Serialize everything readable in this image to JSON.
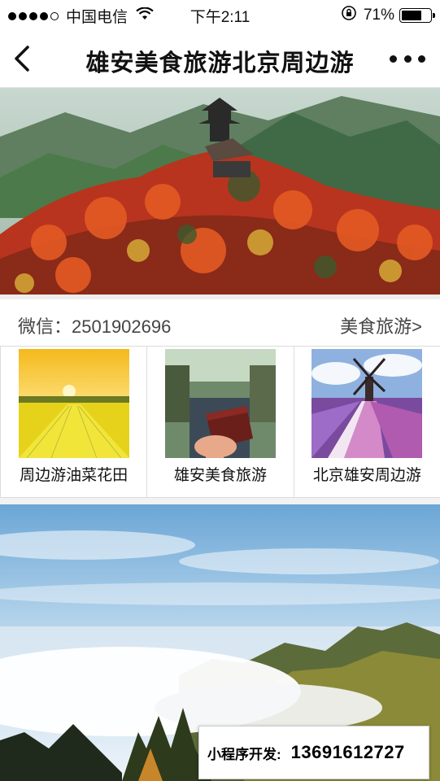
{
  "status_bar": {
    "carrier": "中国电信",
    "time": "下午2:11",
    "battery_percent": "71%",
    "battery_level": 0.71,
    "signal_icon": "signal-dots-icon",
    "wifi_icon": "wifi-icon",
    "lock_icon": "orientation-lock-icon"
  },
  "nav": {
    "title": "雄安美食旅游北京周边游",
    "back_icon": "chevron-left-icon",
    "more_icon": "more-dots-icon"
  },
  "info": {
    "wechat": "微信：2501902696",
    "category_link": "美食旅游>"
  },
  "grid": [
    {
      "label": "周边游油菜花田",
      "image": "canola-field-sunset"
    },
    {
      "label": "雄安美食旅游",
      "image": "cake-by-canal"
    },
    {
      "label": "北京雄安周边游",
      "image": "windmill-flower-field"
    }
  ],
  "badge": {
    "label": "小程序开发:",
    "phone": "13691612727"
  },
  "colors": {
    "background": "#ffffff",
    "separator": "#eeeeee",
    "text": "#111111",
    "secondary_text": "#444444"
  }
}
